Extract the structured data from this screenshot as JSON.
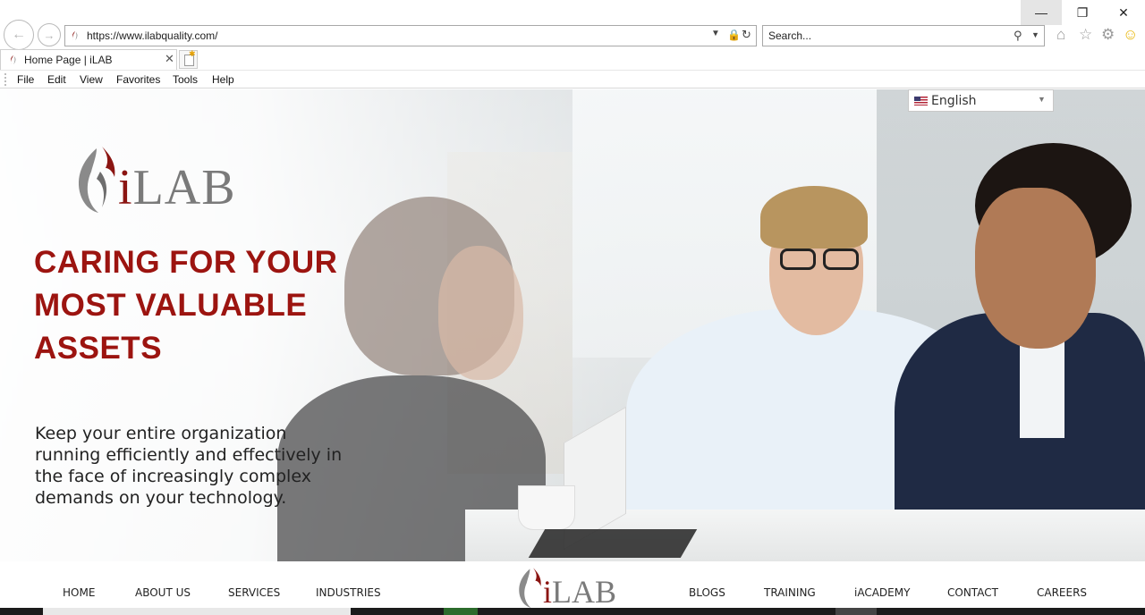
{
  "browser": {
    "url": "https://www.ilabquality.com/",
    "search_placeholder": "Search...",
    "tab_title": "Home Page | iLAB",
    "menu": [
      "File",
      "Edit",
      "View",
      "Favorites",
      "Tools",
      "Help"
    ],
    "icons": {
      "back": "back-arrow-icon",
      "forward": "forward-arrow-icon",
      "home": "home-icon",
      "favorites": "star-icon",
      "settings": "gear-icon",
      "feedback": "smiley-icon"
    }
  },
  "language_selector": {
    "label": "English"
  },
  "hero": {
    "logo_text_i": "i",
    "logo_text_rest": "LAB",
    "headline_lines": [
      "CARING FOR YOUR",
      "MOST VALUABLE",
      "ASSETS"
    ],
    "subtext": "Keep your entire organization running efficiently and effectively in the face of increasingly complex demands on your technology."
  },
  "site_nav": {
    "left": [
      "HOME",
      "ABOUT US",
      "SERVICES",
      "INDUSTRIES"
    ],
    "right": [
      "BLOGS",
      "TRAINING",
      "iACADEMY",
      "CONTACT",
      "CAREERS"
    ],
    "logo_i": "i",
    "logo_rest": "LAB"
  },
  "colors": {
    "brand_red": "#9c1410",
    "logo_grey": "#7a7a7a"
  }
}
